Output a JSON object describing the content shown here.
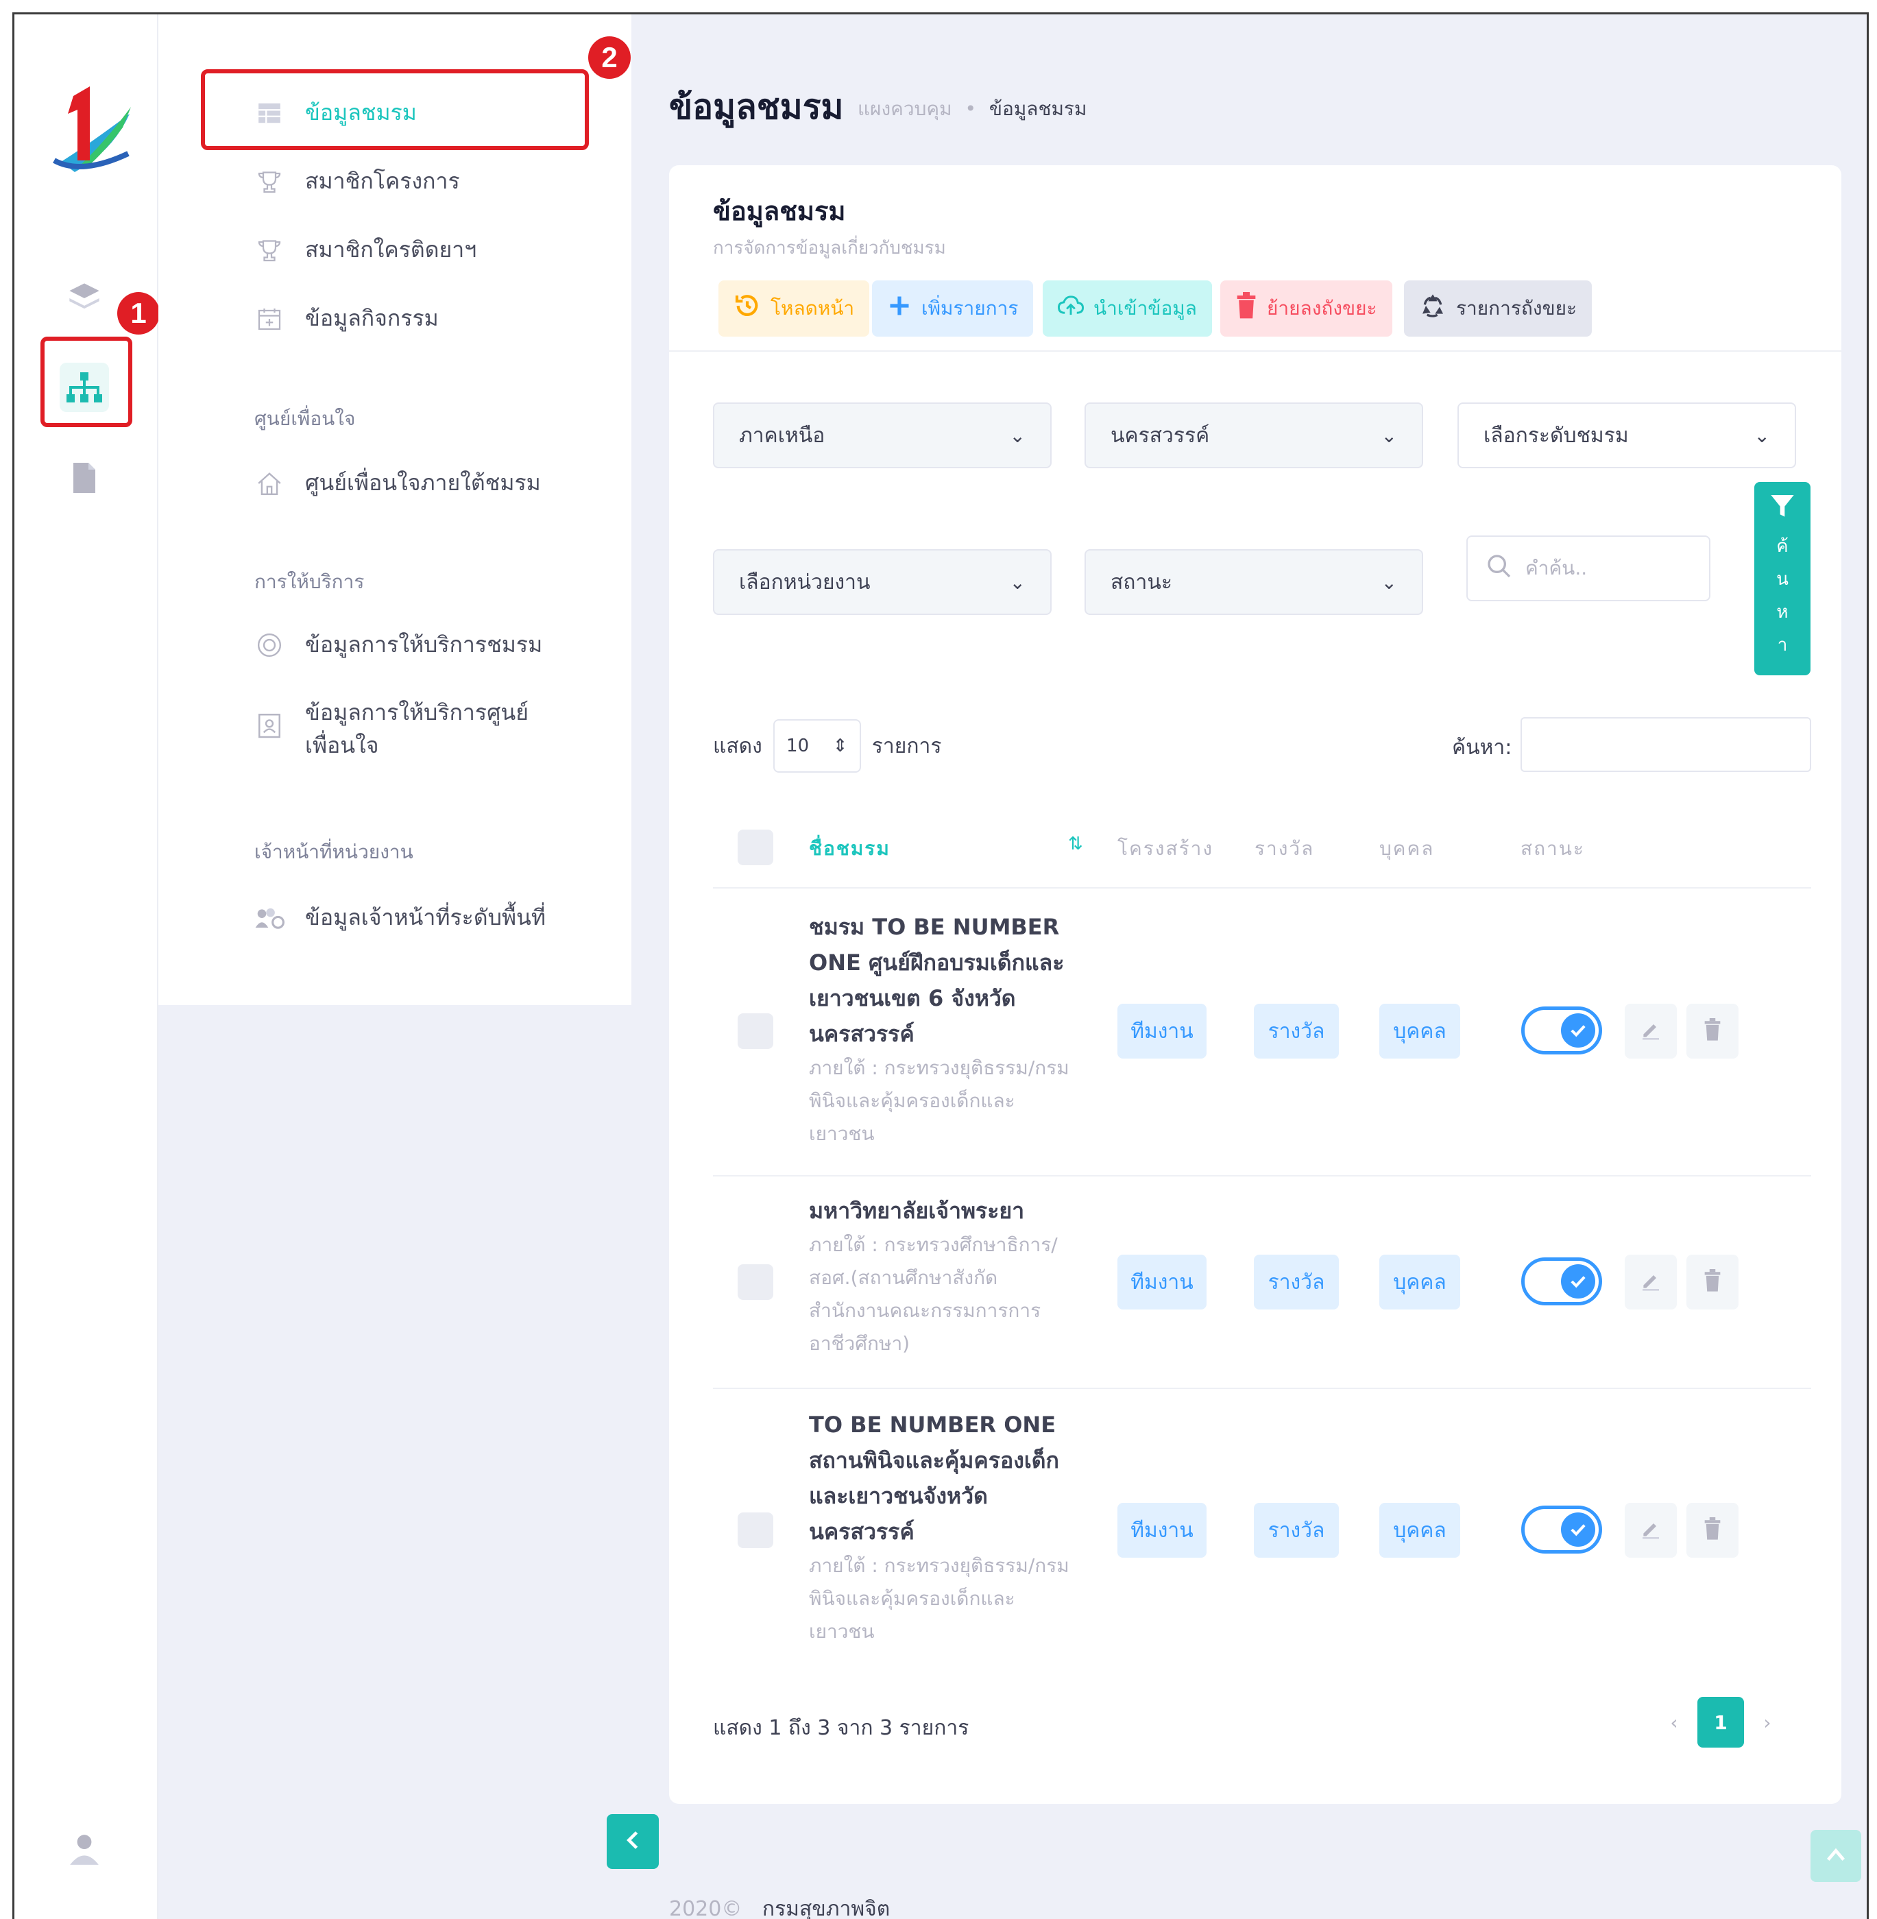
{
  "sidebar": {
    "items": [
      {
        "label": "ข้อมูลชมรม",
        "icon": "table-icon"
      },
      {
        "label": "สมาชิกโครงการ",
        "icon": "trophy-icon"
      },
      {
        "label": "สมาชิกใครติดยาฯ",
        "icon": "trophy-icon"
      },
      {
        "label": "ข้อมูลกิจกรรม",
        "icon": "calendar-plus-icon"
      }
    ],
    "sections": {
      "center": "ศูนย์เพื่อนใจ",
      "service": "การให้บริการ",
      "staff": "เจ้าหน้าที่หน่วยงาน"
    },
    "center_item": "ศูนย์เพื่อนใจภายใต้ชมรม",
    "service_items": [
      "ข้อมูลการให้บริการชมรม",
      "ข้อมูลการให้บริการศูนย์",
      "เพื่อนใจ"
    ],
    "staff_item": "ข้อมูลเจ้าหน้าที่ระดับพื้นที่"
  },
  "annotations": {
    "rail_marker": "1",
    "menu_marker": "2"
  },
  "header": {
    "title": "ข้อมูลชมรม",
    "breadcrumb": [
      "แผงควบคุม",
      "•",
      "ข้อมูลชมรม"
    ]
  },
  "card": {
    "title": "ข้อมูลชมรม",
    "subtitle": "การจัดการข้อมูลเกี่ยวกับชมรม",
    "toolbar": {
      "reload": "โหลดหน้า",
      "add": "เพิ่มรายการ",
      "import": "นำเข้าข้อมูล",
      "trash": "ย้ายลงถังขยะ",
      "recycle": "รายการถังขยะ"
    },
    "colors": {
      "accent": "#1bbbb0",
      "primary": "#3699ff"
    }
  },
  "filters": {
    "region": "ภาคเหนือ",
    "province": "นครสวรรค์",
    "level": "เลือกระดับชมรม",
    "unit": "เลือกหน่วยงาน",
    "status": "สถานะ",
    "search_placeholder": "คำค้น..",
    "search_button": [
      "ค้",
      "น",
      "ห",
      "า"
    ]
  },
  "length": {
    "prefix": "แสดง",
    "value": "10",
    "suffix": "รายการ",
    "find_label": "ค้นหา:"
  },
  "table": {
    "headers": {
      "name": "ชื่อชมรม",
      "structure": "โครงสร้าง",
      "award": "รางวัล",
      "person": "บุคคล",
      "status": "สถานะ"
    },
    "rows": [
      {
        "name": "ชมรม TO BE NUMBER ONE ศูนย์ฝึกอบรมเด็กและเยาวชนเขต 6 จังหวัดนครสวรรค์",
        "under": "ภายใต้ : กระทรวงยุติธรรม/กรมพินิจและคุ้มครองเด็กและเยาวชน",
        "team": "ทีมงาน",
        "award": "รางวัล",
        "person": "บุคคล",
        "active": true
      },
      {
        "name": "มหาวิทยาลัยเจ้าพระยา",
        "under": "ภายใต้ : กระทรวงศึกษาธิการ/สอศ.(สถานศึกษาสังกัดสำนักงานคณะกรรมการการอาชีวศึกษา)",
        "team": "ทีมงาน",
        "award": "รางวัล",
        "person": "บุคคล",
        "active": true
      },
      {
        "name": "TO BE NUMBER ONE สถานพินิจและคุ้มครองเด็กและเยาวชนจังหวัดนครสวรรค์",
        "under": "ภายใต้ : กระทรวงยุติธรรม/กรมพินิจและคุ้มครองเด็กและเยาวชน",
        "team": "ทีมงาน",
        "award": "รางวัล",
        "person": "บุคคล",
        "active": true
      }
    ]
  },
  "pagination": {
    "info": "แสดง 1 ถึง 3 จาก 3 รายการ",
    "prev": "‹",
    "current": "1",
    "next": "›"
  },
  "footer": {
    "year": "2020©",
    "org": "กรมสุขภาพจิต"
  }
}
